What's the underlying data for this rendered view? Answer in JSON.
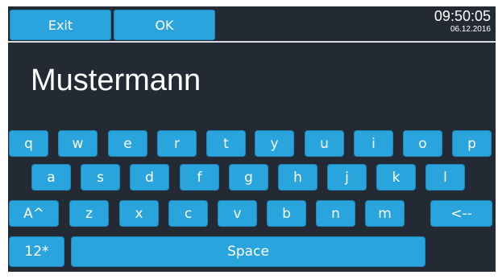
{
  "header": {
    "exit_label": "Exit",
    "ok_label": "OK",
    "time": "09:50:05",
    "date": "06.12.2016"
  },
  "input": {
    "value": "Mustermann"
  },
  "keyboard": {
    "row1": [
      "q",
      "w",
      "e",
      "r",
      "t",
      "y",
      "u",
      "i",
      "o",
      "p"
    ],
    "row2": [
      "a",
      "s",
      "d",
      "f",
      "g",
      "h",
      "j",
      "k",
      "l"
    ],
    "row3": [
      "A^",
      "z",
      "x",
      "c",
      "v",
      "b",
      "n",
      "m",
      "<--"
    ],
    "row4": [
      "12*",
      "Space"
    ]
  },
  "colors": {
    "key_background": "#2aa4dd",
    "screen_background": "#232a33",
    "text": "#ffffff"
  }
}
